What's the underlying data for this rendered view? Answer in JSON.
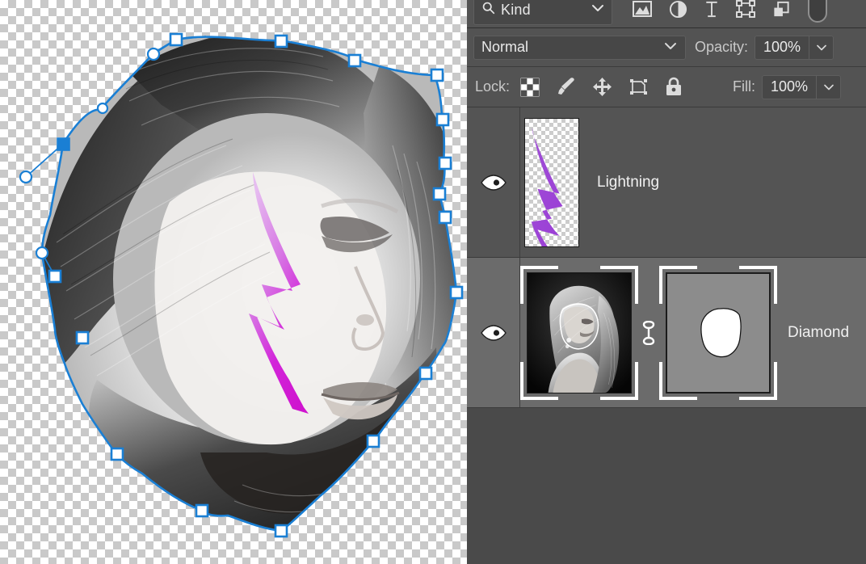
{
  "app": "Adobe Photoshop — Layers panel",
  "canvas": {
    "name": "document-canvas",
    "transparency_checker": true,
    "path_stroke_color": "#1a7fd4",
    "anchor_fill_selected": "#1a7fd4",
    "anchor_fill_unselected": "#ffffff",
    "lightning_gradient_start": "#e9b9ee",
    "lightning_gradient_end": "#d21fd2",
    "selected_anchor_count": 2,
    "unselected_anchor_count": 16,
    "handle_count": 4
  },
  "panel": {
    "filter": {
      "kind_label": "Kind",
      "search_icon": "search-icon",
      "chevron_icon": "chevron-down-icon",
      "type_filters": [
        {
          "name": "filter-pixel-layers",
          "icon": "image-icon",
          "title": "Pixel layers"
        },
        {
          "name": "filter-adjustment-layers",
          "icon": "adjustment-icon",
          "title": "Adjustment layers"
        },
        {
          "name": "filter-type-layers",
          "icon": "type-icon",
          "title": "Type layers"
        },
        {
          "name": "filter-shape-layers",
          "icon": "shape-icon",
          "title": "Shape layers"
        },
        {
          "name": "filter-smart-objects",
          "icon": "smart-object-icon",
          "title": "Smart objects"
        }
      ],
      "toggle": {
        "name": "filter-toggle",
        "state": "off"
      }
    },
    "blend": {
      "mode": "Normal",
      "opacity_label": "Opacity:",
      "opacity_value": "100%"
    },
    "lock": {
      "label": "Lock:",
      "items": [
        {
          "name": "lock-transparent-pixels",
          "icon": "checkerboard-icon"
        },
        {
          "name": "lock-image-pixels",
          "icon": "brush-icon"
        },
        {
          "name": "lock-position",
          "icon": "move-arrows-icon"
        },
        {
          "name": "lock-artboard-nesting",
          "icon": "artboard-icon"
        },
        {
          "name": "lock-all",
          "icon": "lock-icon"
        }
      ],
      "fill_label": "Fill:",
      "fill_value": "100%"
    },
    "layers": [
      {
        "name": "Lightning",
        "visible": true,
        "selected": false,
        "thumbnail": "transparent-lightning-bolt",
        "has_mask": false
      },
      {
        "name": "Diamond",
        "visible": true,
        "selected": true,
        "thumbnail": "bw-portrait-photo",
        "has_mask": true,
        "mask_linked": true,
        "mask_thumbnail": "white-blob-on-gray"
      }
    ]
  },
  "colors": {
    "panel_bg": "#4a4a4a",
    "row_bg": "#545454",
    "row_selected_bg": "#6b6b6b",
    "toolbar_bg": "#535353",
    "field_bg": "#474747",
    "text": "#eaeaea",
    "accent_path": "#1a7fd4"
  }
}
